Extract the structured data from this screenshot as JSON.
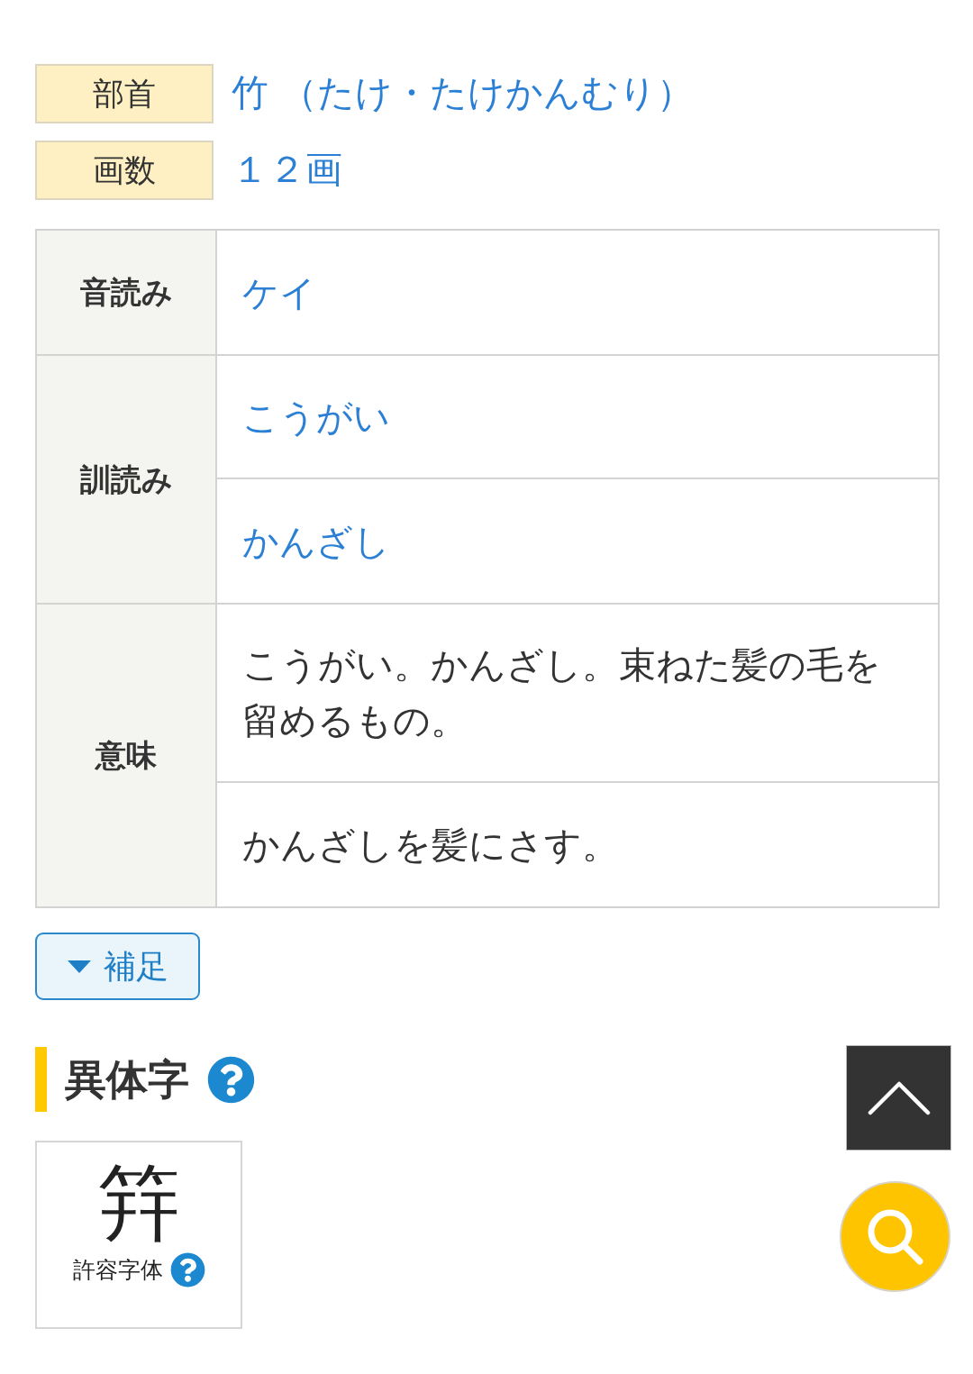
{
  "info_rows": [
    {
      "label": "部首",
      "value": "竹 （たけ・たけかんむり）"
    },
    {
      "label": "画数",
      "value": "１２画"
    }
  ],
  "readings_table": {
    "groups": [
      {
        "heading": "音読み",
        "kind": "link",
        "entries": [
          "ケイ"
        ]
      },
      {
        "heading": "訓読み",
        "kind": "link",
        "entries": [
          "こうがい",
          "かんざし"
        ]
      },
      {
        "heading": "意味",
        "kind": "text",
        "entries": [
          "こうがい。かんざし。束ねた髪の毛を留めるもの。",
          "かんざしを髪にさす。"
        ]
      }
    ]
  },
  "supplement_button": {
    "label": "補足",
    "expanded": false
  },
  "variants_section": {
    "title": "異体字",
    "variants": [
      {
        "character": "筓",
        "caption": "許容字体"
      }
    ]
  }
}
